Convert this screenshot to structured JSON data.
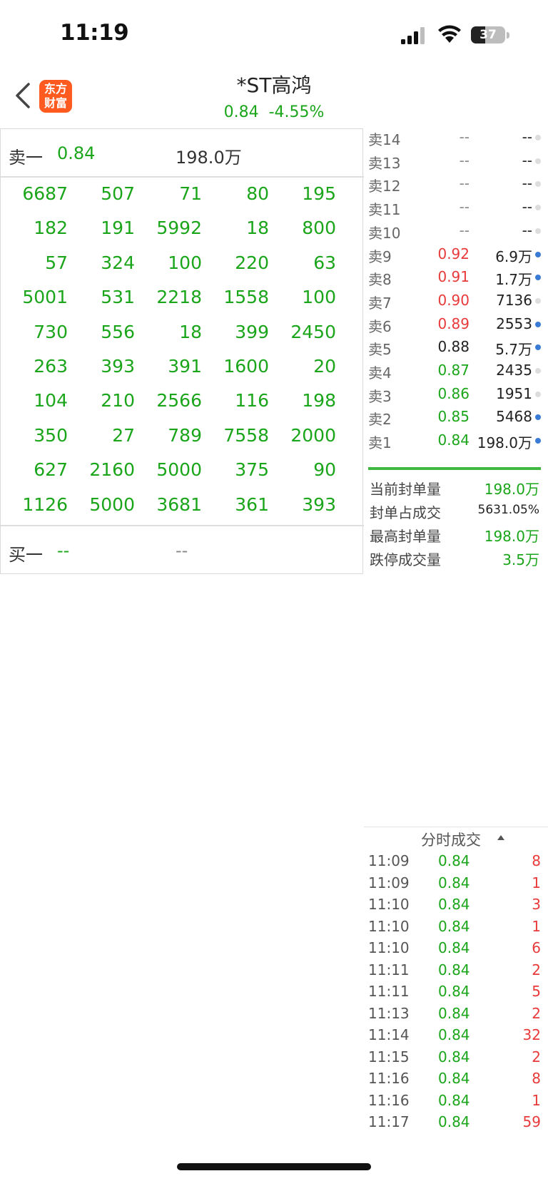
{
  "status_bar": {
    "time": "11:19",
    "battery": "37"
  },
  "header": {
    "logo_line1": "东方",
    "logo_line2": "财富",
    "stock_name": "*ST高鸿",
    "price": "0.84",
    "change_pct": "-4.55%"
  },
  "left_panel": {
    "sell1": {
      "label": "卖一",
      "price": "0.84",
      "volume": "198.0万"
    },
    "buy1": {
      "label": "买一",
      "price": "--",
      "volume": "--"
    },
    "queue": [
      [
        "6687",
        "507",
        "71",
        "80",
        "195"
      ],
      [
        "182",
        "191",
        "5992",
        "18",
        "800"
      ],
      [
        "57",
        "324",
        "100",
        "220",
        "63"
      ],
      [
        "5001",
        "531",
        "2218",
        "1558",
        "100"
      ],
      [
        "730",
        "556",
        "18",
        "399",
        "2450"
      ],
      [
        "263",
        "393",
        "391",
        "1600",
        "20"
      ],
      [
        "104",
        "210",
        "2566",
        "116",
        "198"
      ],
      [
        "350",
        "27",
        "789",
        "7558",
        "2000"
      ],
      [
        "627",
        "2160",
        "5000",
        "375",
        "90"
      ],
      [
        "1126",
        "5000",
        "3681",
        "361",
        "393"
      ]
    ]
  },
  "order_book": [
    {
      "label": "卖14",
      "price": "--",
      "volume": "--",
      "price_color": "dash",
      "dot_color": "#dddddd"
    },
    {
      "label": "卖13",
      "price": "--",
      "volume": "--",
      "price_color": "dash",
      "dot_color": "#dddddd"
    },
    {
      "label": "卖12",
      "price": "--",
      "volume": "--",
      "price_color": "dash",
      "dot_color": "#dddddd"
    },
    {
      "label": "卖11",
      "price": "--",
      "volume": "--",
      "price_color": "dash",
      "dot_color": "#dddddd"
    },
    {
      "label": "卖10",
      "price": "--",
      "volume": "--",
      "price_color": "dash",
      "dot_color": "#dddddd"
    },
    {
      "label": "卖9",
      "price": "0.92",
      "volume": "6.9万",
      "price_color": "red",
      "dot_color": "#3a7bd5"
    },
    {
      "label": "卖8",
      "price": "0.91",
      "volume": "1.7万",
      "price_color": "red",
      "dot_color": "#3a7bd5"
    },
    {
      "label": "卖7",
      "price": "0.90",
      "volume": "7136",
      "price_color": "red",
      "dot_color": "#dddddd"
    },
    {
      "label": "卖6",
      "price": "0.89",
      "volume": "2553",
      "price_color": "red",
      "dot_color": "#3a7bd5"
    },
    {
      "label": "卖5",
      "price": "0.88",
      "volume": "5.7万",
      "price_color": "dark",
      "dot_color": "#3a7bd5"
    },
    {
      "label": "卖4",
      "price": "0.87",
      "volume": "2435",
      "price_color": "green",
      "dot_color": "#dddddd"
    },
    {
      "label": "卖3",
      "price": "0.86",
      "volume": "1951",
      "price_color": "green",
      "dot_color": "#dddddd"
    },
    {
      "label": "卖2",
      "price": "0.85",
      "volume": "5468",
      "price_color": "green",
      "dot_color": "#3a7bd5"
    },
    {
      "label": "卖1",
      "price": "0.84",
      "volume": "198.0万",
      "price_color": "green",
      "dot_color": "#3a7bd5"
    }
  ],
  "stats": [
    {
      "label": "当前封单量",
      "value": "198.0万"
    },
    {
      "label": "封单占成交",
      "value": "5631.05%"
    },
    {
      "label": "最高封单量",
      "value": "198.0万"
    },
    {
      "label": "跌停成交量",
      "value": "3.5万"
    }
  ],
  "trades": {
    "header": "分时成交",
    "rows": [
      {
        "time": "11:09",
        "price": "0.84",
        "volume": "8"
      },
      {
        "time": "11:09",
        "price": "0.84",
        "volume": "1"
      },
      {
        "time": "11:10",
        "price": "0.84",
        "volume": "3"
      },
      {
        "time": "11:10",
        "price": "0.84",
        "volume": "1"
      },
      {
        "time": "11:10",
        "price": "0.84",
        "volume": "6"
      },
      {
        "time": "11:11",
        "price": "0.84",
        "volume": "2"
      },
      {
        "time": "11:11",
        "price": "0.84",
        "volume": "5"
      },
      {
        "time": "11:13",
        "price": "0.84",
        "volume": "2"
      },
      {
        "time": "11:14",
        "price": "0.84",
        "volume": "32"
      },
      {
        "time": "11:15",
        "price": "0.84",
        "volume": "2"
      },
      {
        "time": "11:16",
        "price": "0.84",
        "volume": "8"
      },
      {
        "time": "11:16",
        "price": "0.84",
        "volume": "1"
      },
      {
        "time": "11:17",
        "price": "0.84",
        "volume": "59"
      }
    ]
  }
}
